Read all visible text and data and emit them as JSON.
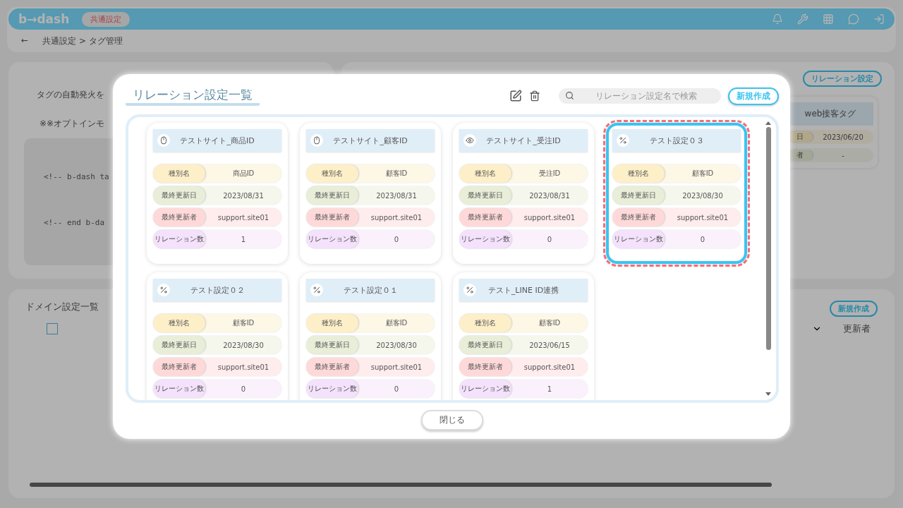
{
  "header": {
    "logo": "b→dash",
    "section_badge": "共通設定"
  },
  "breadcrumb": {
    "back": "←",
    "path": "共通設定 > タグ管理"
  },
  "left_panel": {
    "text_1": "タグの自動発火を",
    "text_2": "※※オプトインモ",
    "code_lines": [
      "<!-- b-dash ta",
      "<!-- end b-da"
    ]
  },
  "right_panel": {
    "button": "リレーション設定",
    "tag_card": {
      "title": "web接客タグ",
      "rows": [
        {
          "label": "日",
          "value": "2023/06/20"
        },
        {
          "label": "者",
          "value": "-"
        }
      ]
    }
  },
  "domain_panel": {
    "title": "ドメイン設定一覧",
    "checked": false,
    "new_button": "新規作成",
    "column": "更新者"
  },
  "modal": {
    "title": "リレーション設定一覧",
    "search": {
      "placeholder": "リレーション設定名で検索"
    },
    "new_button": "新規作成",
    "close_button": "閉じる",
    "cards": [
      {
        "name": "テストサイト_商品ID",
        "kind": "click",
        "selected": false,
        "fields": [
          {
            "label": "種別名",
            "value": "商品ID"
          },
          {
            "label": "最終更新日",
            "value": "2023/08/31"
          },
          {
            "label": "最終更新者",
            "value": "support.site01"
          },
          {
            "label": "リレーション数",
            "value": "1"
          }
        ]
      },
      {
        "name": "テストサイト_顧客ID",
        "kind": "click",
        "selected": false,
        "fields": [
          {
            "label": "種別名",
            "value": "顧客ID"
          },
          {
            "label": "最終更新日",
            "value": "2023/08/31"
          },
          {
            "label": "最終更新者",
            "value": "support.site01"
          },
          {
            "label": "リレーション数",
            "value": "0"
          }
        ]
      },
      {
        "name": "テストサイト_受注ID",
        "kind": "view",
        "selected": false,
        "fields": [
          {
            "label": "種別名",
            "value": "受注ID"
          },
          {
            "label": "最終更新日",
            "value": "2023/08/31"
          },
          {
            "label": "最終更新者",
            "value": "support.site01"
          },
          {
            "label": "リレーション数",
            "value": "0"
          }
        ]
      },
      {
        "name": "テスト設定０３",
        "kind": "custom",
        "selected": true,
        "fields": [
          {
            "label": "種別名",
            "value": "顧客ID"
          },
          {
            "label": "最終更新日",
            "value": "2023/08/30"
          },
          {
            "label": "最終更新者",
            "value": "support.site01"
          },
          {
            "label": "リレーション数",
            "value": "0"
          }
        ]
      },
      {
        "name": "テスト設定０２",
        "kind": "custom",
        "selected": false,
        "fields": [
          {
            "label": "種別名",
            "value": "顧客ID"
          },
          {
            "label": "最終更新日",
            "value": "2023/08/30"
          },
          {
            "label": "最終更新者",
            "value": "support.site01"
          },
          {
            "label": "リレーション数",
            "value": "0"
          }
        ]
      },
      {
        "name": "テスト設定０１",
        "kind": "custom",
        "selected": false,
        "fields": [
          {
            "label": "種別名",
            "value": "顧客ID"
          },
          {
            "label": "最終更新日",
            "value": "2023/08/30"
          },
          {
            "label": "最終更新者",
            "value": "support.site01"
          },
          {
            "label": "リレーション数",
            "value": "0"
          }
        ]
      },
      {
        "name": "テスト_LINE ID連携",
        "kind": "custom",
        "selected": false,
        "fields": [
          {
            "label": "種別名",
            "value": "顧客ID"
          },
          {
            "label": "最終更新日",
            "value": "2023/06/15"
          },
          {
            "label": "最終更新者",
            "value": "support.site01"
          },
          {
            "label": "リレーション数",
            "value": "1"
          }
        ]
      }
    ]
  }
}
